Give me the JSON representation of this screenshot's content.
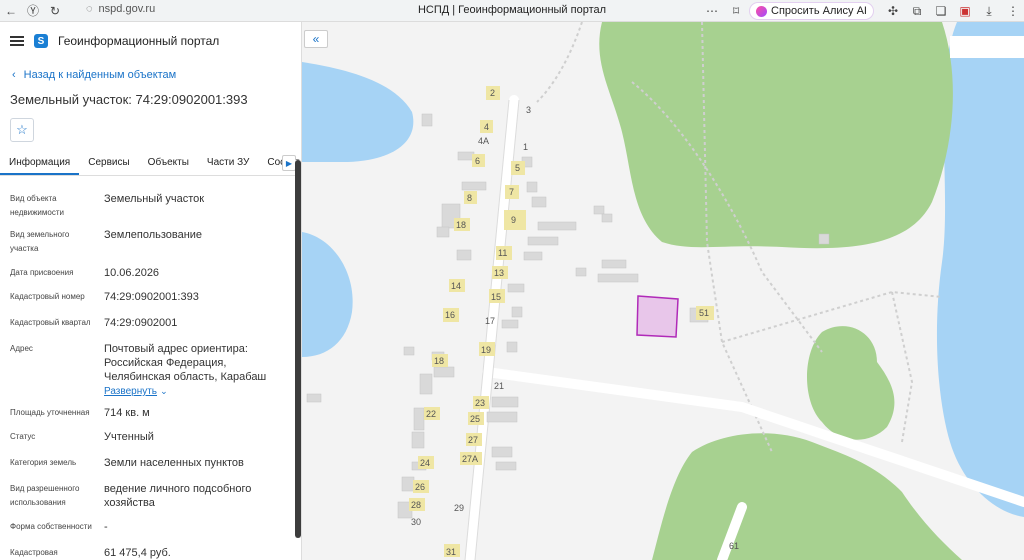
{
  "browser": {
    "url": "nspd.gov.ru",
    "tab_title": "НСПД | Геоинформационный портал",
    "alice_label": "Спросить Алису AI"
  },
  "header": {
    "title": "Геоинформационный портал"
  },
  "back_link": "Назад к найденным объектам",
  "object_title": "Земельный участок: 74:29:0902001:393",
  "tabs": [
    "Информация",
    "Сервисы",
    "Объекты",
    "Части ЗУ",
    "Состав"
  ],
  "properties": [
    {
      "label": "Вид объекта недвижимости",
      "value": "Земельный участок"
    },
    {
      "label": "Вид земельного участка",
      "value": "Землепользование"
    },
    {
      "label": "Дата присвоения",
      "value": "10.06.2026"
    },
    {
      "label": "Кадастровый номер",
      "value": "74:29:0902001:393"
    },
    {
      "label": "Кадастровый квартал",
      "value": "74:29:0902001"
    },
    {
      "label": "Адрес",
      "value": "Почтовый адрес ориентира:\nРоссийская Федерация,\nЧелябинская область, Карабаш"
    },
    {
      "label": "Площадь уточненная",
      "value": "714 кв. м"
    },
    {
      "label": "Статус",
      "value": "Учтенный"
    },
    {
      "label": "Категория земель",
      "value": "Земли населенных пунктов"
    },
    {
      "label": "Вид разрешенного использования",
      "value": "ведение личного подсобного\nхозяйства"
    },
    {
      "label": "Форма собственности",
      "value": "-"
    },
    {
      "label": "Кадастровая",
      "value": "61 475,4 руб."
    }
  ],
  "expand_label": "Развернуть",
  "map": {
    "house_numbers": [
      "2",
      "3",
      "4",
      "4А",
      "1",
      "6",
      "5",
      "7",
      "8",
      "9",
      "18",
      "11",
      "13",
      "14",
      "15",
      "16",
      "17",
      "51",
      "19",
      "18",
      "21",
      "23",
      "22",
      "25",
      "27",
      "24",
      "27А",
      "26",
      "28",
      "29",
      "30",
      "31",
      "61"
    ],
    "colors": {
      "water": "#a6d3f5",
      "forest": "#a7d190",
      "road": "#ffffff",
      "building": "#d9d9d9",
      "house": "#efe6a4",
      "parcel_fill": "#e8c6ea",
      "parcel_stroke": "#b02ab8"
    }
  }
}
